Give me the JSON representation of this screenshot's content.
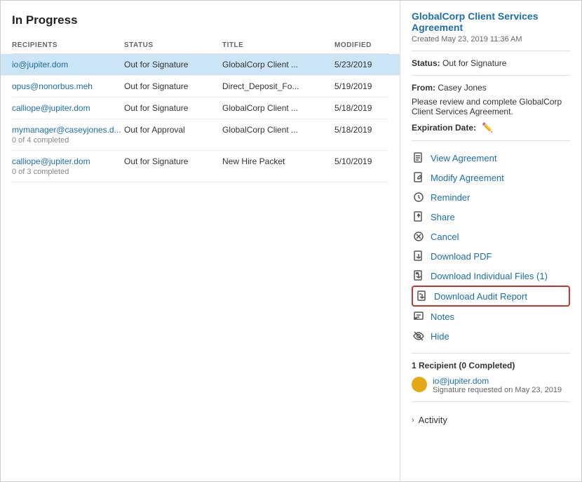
{
  "page": {
    "title": "In Progress"
  },
  "table": {
    "headers": [
      "RECIPIENTS",
      "STATUS",
      "TITLE",
      "MODIFIED"
    ],
    "rows": [
      {
        "recipient": "io@jupiter.dom",
        "status": "Out for Signature",
        "title": "GlobalCorp Client ...",
        "modified": "5/23/2019",
        "sublabel": "",
        "selected": true
      },
      {
        "recipient": "opus@nonorbus.meh",
        "status": "Out for Signature",
        "title": "Direct_Deposit_Fo...",
        "modified": "5/19/2019",
        "sublabel": "",
        "selected": false
      },
      {
        "recipient": "calliope@jupiter.dom",
        "status": "Out for Signature",
        "title": "GlobalCorp Client ...",
        "modified": "5/18/2019",
        "sublabel": "",
        "selected": false
      },
      {
        "recipient": "mymanager@caseyjones.d...",
        "status": "Out for Approval",
        "title": "GlobalCorp Client ...",
        "modified": "5/18/2019",
        "sublabel": "0 of 4 completed",
        "selected": false
      },
      {
        "recipient": "calliope@jupiter.dom",
        "status": "Out for Signature",
        "title": "New Hire Packet",
        "modified": "5/10/2019",
        "sublabel": "0 of 3 completed",
        "selected": false
      }
    ]
  },
  "detail": {
    "title": "GlobalCorp Client Services Agreement",
    "created": "Created May 23, 2019 11:36 AM",
    "status_label": "Status:",
    "status_value": "Out for Signature",
    "from_label": "From:",
    "from_value": "Casey Jones",
    "message": "Please review and complete GlobalCorp Client Services Agreement.",
    "expiration_label": "Expiration Date:",
    "actions": [
      {
        "id": "view-agreement",
        "label": "View Agreement",
        "icon": "📄",
        "highlighted": false
      },
      {
        "id": "modify-agreement",
        "label": "Modify Agreement",
        "icon": "✏️",
        "highlighted": false
      },
      {
        "id": "reminder",
        "label": "Reminder",
        "icon": "⏰",
        "highlighted": false
      },
      {
        "id": "share",
        "label": "Share",
        "icon": "📤",
        "highlighted": false
      },
      {
        "id": "cancel",
        "label": "Cancel",
        "icon": "🚫",
        "highlighted": false
      },
      {
        "id": "download-pdf",
        "label": "Download PDF",
        "icon": "⬇️",
        "highlighted": false
      },
      {
        "id": "download-individual-files",
        "label": "Download Individual Files (1)",
        "icon": "⬇️",
        "highlighted": false
      },
      {
        "id": "download-audit-report",
        "label": "Download Audit Report",
        "icon": "⬇️",
        "highlighted": true
      },
      {
        "id": "notes",
        "label": "Notes",
        "icon": "💬",
        "highlighted": false
      },
      {
        "id": "hide",
        "label": "Hide",
        "icon": "🙈",
        "highlighted": false
      }
    ],
    "recipients_title": "1 Recipient (0 Completed)",
    "recipients": [
      {
        "email": "io@jupiter.dom",
        "sub": "Signature requested on May 23, 2019"
      }
    ],
    "activity_label": "Activity"
  }
}
